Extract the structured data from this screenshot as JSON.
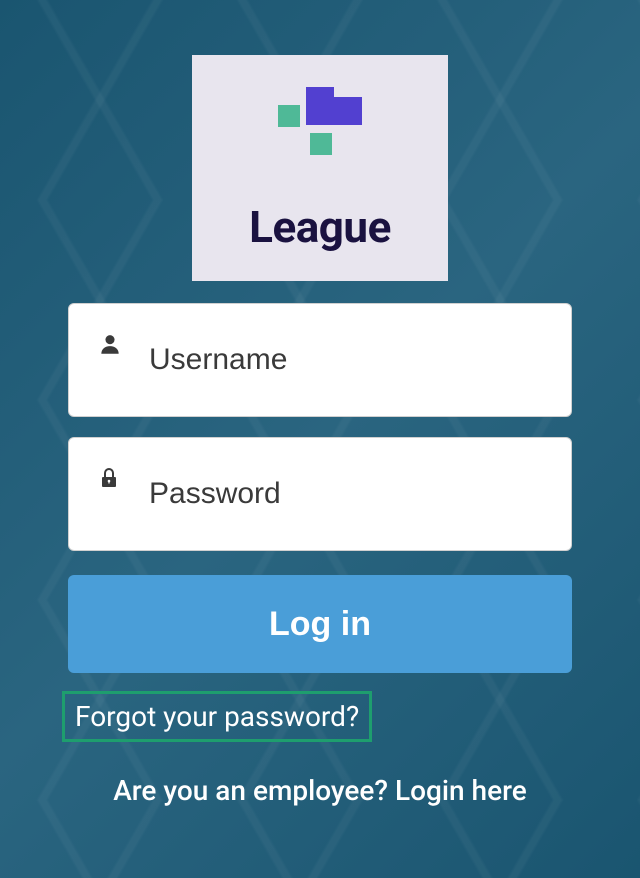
{
  "brand": {
    "name": "League"
  },
  "form": {
    "username": {
      "placeholder": "Username",
      "value": ""
    },
    "password": {
      "placeholder": "Password",
      "value": ""
    },
    "submit_label": "Log in"
  },
  "links": {
    "forgot_password": "Forgot your password?",
    "employee_login": "Are you an employee? Login here"
  },
  "colors": {
    "accent_purple": "#5240d0",
    "accent_teal": "#4fb997",
    "button_blue": "#4a9ed8",
    "highlight_green": "#1e9e6e"
  }
}
